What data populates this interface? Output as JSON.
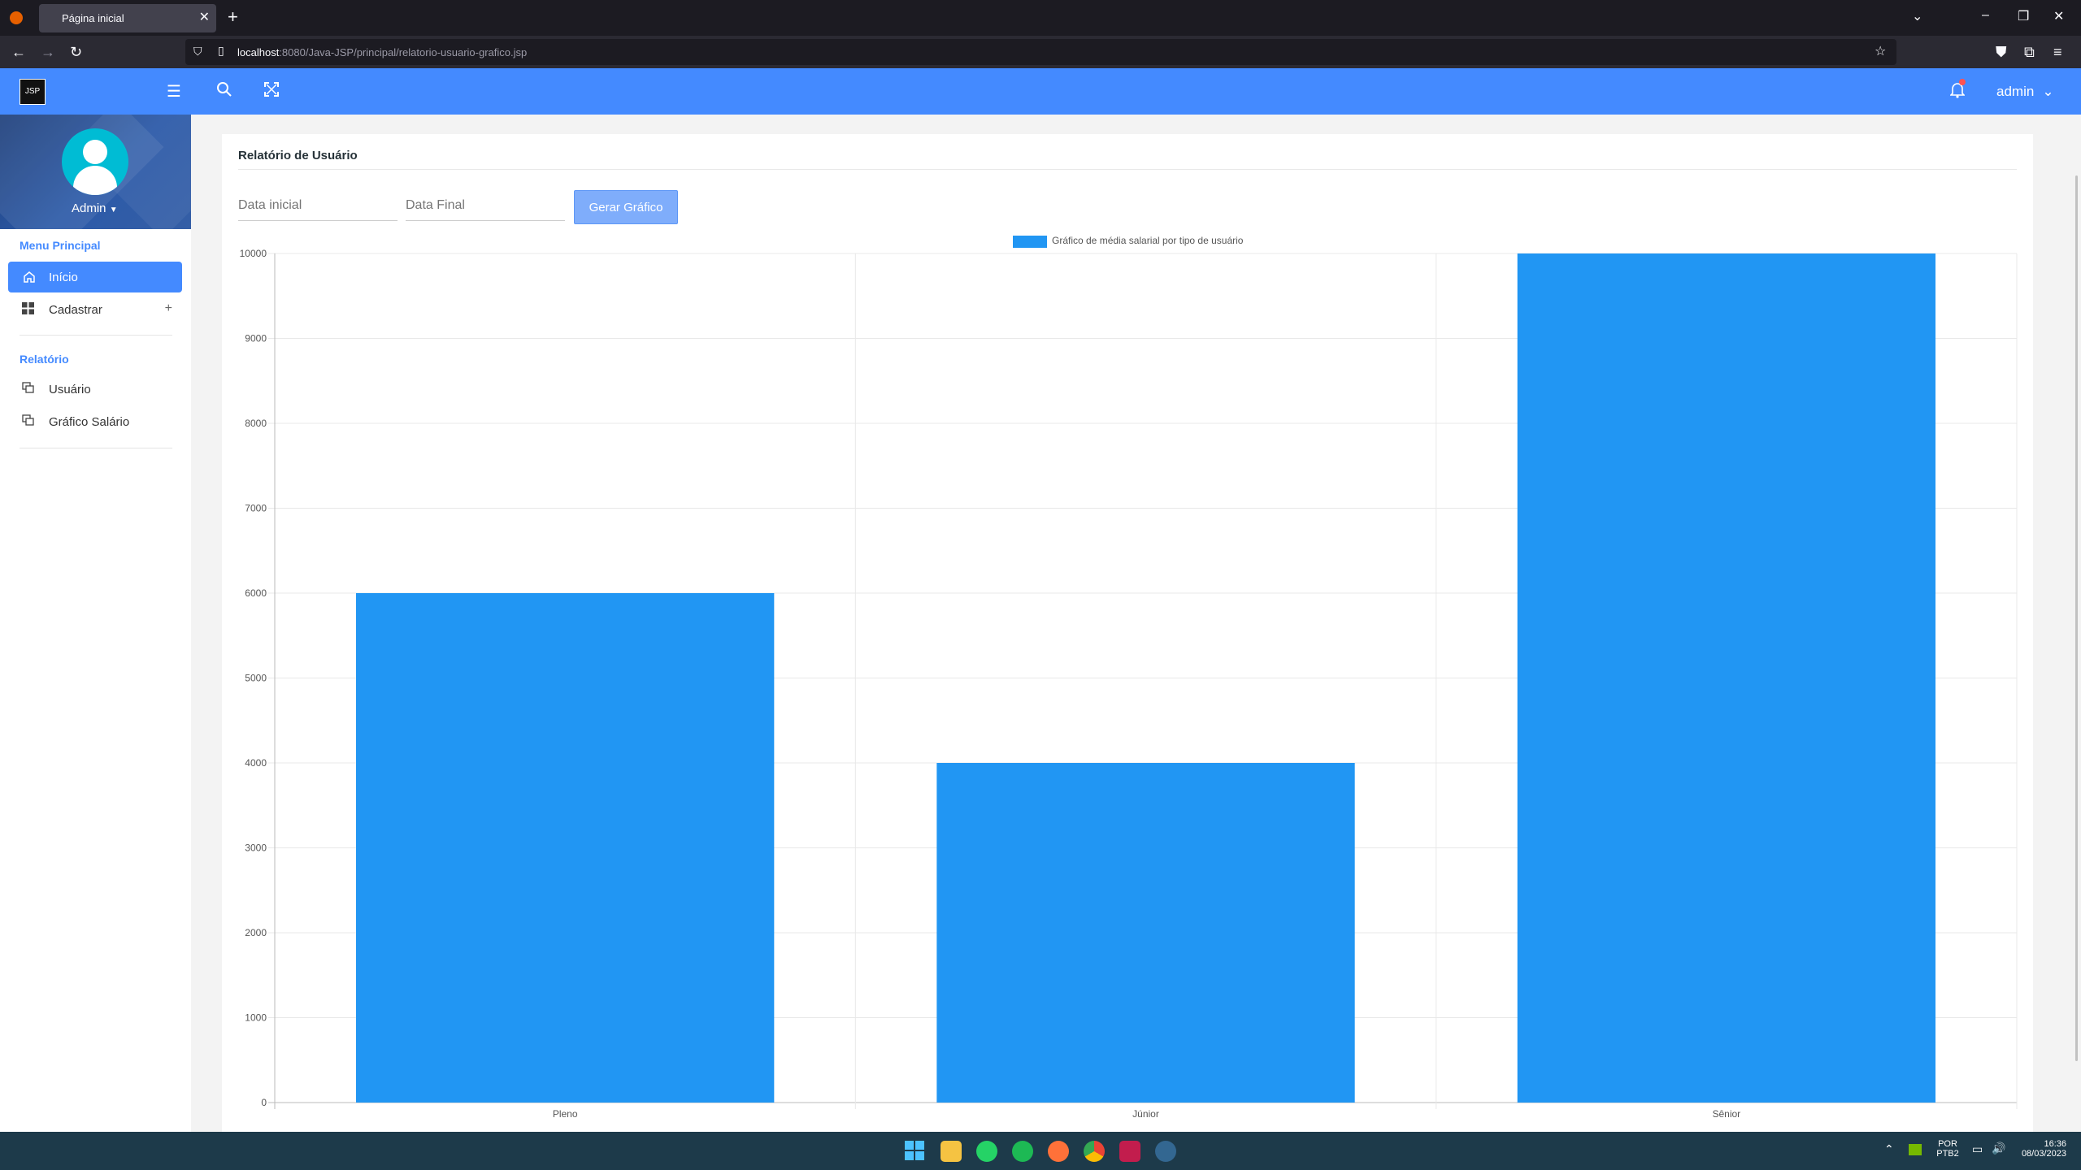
{
  "browser": {
    "tab_title": "Página inicial",
    "url_host": "localhost",
    "url_rest": ":8080/Java-JSP/principal/relatorio-usuario-grafico.jsp"
  },
  "header": {
    "logo_text": "JSP",
    "user": "admin"
  },
  "sidebar": {
    "profile_name": "Admin",
    "sections": [
      {
        "caption": "Menu Principal",
        "items": [
          {
            "label": "Início",
            "active": true,
            "icon": "home-icon"
          },
          {
            "label": "Cadastrar",
            "active": false,
            "icon": "grid-icon"
          }
        ]
      },
      {
        "caption": "Relatório",
        "items": [
          {
            "label": "Usuário",
            "icon": "copy-icon"
          },
          {
            "label": "Gráfico Salário",
            "icon": "copy-icon"
          }
        ]
      }
    ]
  },
  "card": {
    "title": "Relatório de Usuário",
    "date_initial_placeholder": "Data inicial",
    "date_final_placeholder": "Data Final",
    "button_label": "Gerar Gráfico"
  },
  "chart_data": {
    "type": "bar",
    "legend": "Gráfico de média salarial por tipo de usuário",
    "legend_position": "top",
    "categories": [
      "Pleno",
      "Júnior",
      "Sênior"
    ],
    "values": [
      6000,
      4000,
      10000
    ],
    "ylim": [
      0,
      10000
    ],
    "yticks": [
      0,
      1000,
      2000,
      3000,
      4000,
      5000,
      6000,
      7000,
      8000,
      9000,
      10000
    ],
    "color": "#2196f3",
    "grid": true
  },
  "taskbar": {
    "lang_top": "POR",
    "lang_bottom": "PTB2",
    "time": "16:36",
    "date": "08/03/2023"
  }
}
